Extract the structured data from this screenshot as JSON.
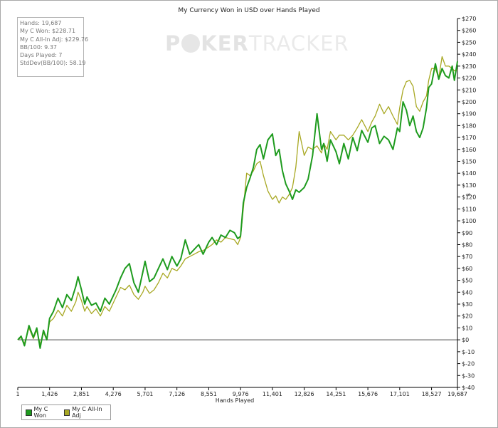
{
  "chart_data": {
    "type": "line",
    "title": "My Currency Won in USD over Hands Played",
    "xlabel": "Hands Played",
    "ylabel": "$",
    "xlim": [
      1,
      19687
    ],
    "ylim": [
      -40,
      270
    ],
    "x_ticks": [
      "1",
      "1,426",
      "2,851",
      "4,276",
      "5,701",
      "7,126",
      "8,551",
      "9,976",
      "11,401",
      "12,826",
      "14,251",
      "15,676",
      "17,101",
      "18,527",
      "19,687"
    ],
    "x_tick_values": [
      1,
      1426,
      2851,
      4276,
      5701,
      7126,
      8551,
      9976,
      11401,
      12826,
      14251,
      15676,
      17101,
      18527,
      19687
    ],
    "y_ticks": [
      "$-40",
      "$-30",
      "$-20",
      "$-10",
      "$0",
      "$10",
      "$20",
      "$30",
      "$40",
      "$50",
      "$60",
      "$70",
      "$80",
      "$90",
      "$100",
      "$110",
      "$120",
      "$130",
      "$140",
      "$150",
      "$160",
      "$170",
      "$180",
      "$190",
      "$200",
      "$210",
      "$220",
      "$230",
      "$240",
      "$250",
      "$260",
      "$270"
    ],
    "y_tick_values": [
      -40,
      -30,
      -20,
      -10,
      0,
      10,
      20,
      30,
      40,
      50,
      60,
      70,
      80,
      90,
      100,
      110,
      120,
      130,
      140,
      150,
      160,
      170,
      180,
      190,
      200,
      210,
      220,
      230,
      240,
      250,
      260,
      270
    ],
    "legend_position": "bottom-left",
    "grid": false,
    "series": [
      {
        "name": "My C Won",
        "color": "#1e9b1e",
        "x": [
          1,
          150,
          300,
          500,
          700,
          850,
          1000,
          1150,
          1300,
          1426,
          1600,
          1800,
          2000,
          2200,
          2400,
          2600,
          2700,
          2851,
          3000,
          3100,
          3300,
          3500,
          3700,
          3900,
          4100,
          4276,
          4400,
          4600,
          4800,
          5000,
          5200,
          5400,
          5600,
          5701,
          5900,
          6100,
          6300,
          6500,
          6700,
          6900,
          7126,
          7300,
          7500,
          7700,
          7900,
          8100,
          8300,
          8551,
          8700,
          8900,
          9100,
          9300,
          9500,
          9700,
          9850,
          9976,
          10100,
          10250,
          10400,
          10550,
          10700,
          10850,
          11000,
          11200,
          11401,
          11550,
          11700,
          11850,
          12000,
          12150,
          12300,
          12450,
          12600,
          12826,
          13000,
          13200,
          13400,
          13600,
          13700,
          13850,
          14000,
          14251,
          14400,
          14600,
          14800,
          15000,
          15200,
          15400,
          15676,
          15850,
          16000,
          16200,
          16400,
          16600,
          16800,
          17000,
          17101,
          17250,
          17400,
          17550,
          17700,
          17850,
          18000,
          18150,
          18300,
          18400,
          18527,
          18700,
          18850,
          19000,
          19150,
          19300,
          19450,
          19550,
          19687
        ],
        "y": [
          0,
          3,
          -5,
          12,
          2,
          10,
          -7,
          8,
          0,
          18,
          24,
          35,
          27,
          38,
          33,
          45,
          53,
          42,
          30,
          36,
          29,
          31,
          24,
          35,
          30,
          37,
          42,
          52,
          60,
          64,
          48,
          40,
          57,
          66,
          49,
          52,
          60,
          68,
          59,
          70,
          62,
          68,
          84,
          72,
          76,
          80,
          72,
          82,
          86,
          80,
          88,
          86,
          92,
          90,
          85,
          87,
          115,
          128,
          136,
          145,
          160,
          164,
          152,
          168,
          173,
          155,
          160,
          142,
          131,
          125,
          118,
          126,
          124,
          128,
          135,
          155,
          190,
          160,
          165,
          150,
          168,
          158,
          148,
          165,
          152,
          170,
          159,
          176,
          166,
          178,
          180,
          165,
          171,
          168,
          160,
          178,
          175,
          200,
          193,
          180,
          188,
          175,
          170,
          178,
          195,
          212,
          215,
          232,
          219,
          228,
          222,
          220,
          230,
          218,
          234
        ]
      },
      {
        "name": "My C All-In Adj",
        "color": "#a8a823",
        "x": [
          1,
          150,
          300,
          500,
          700,
          850,
          1000,
          1150,
          1300,
          1426,
          1600,
          1800,
          2000,
          2200,
          2400,
          2600,
          2700,
          2851,
          3000,
          3100,
          3300,
          3500,
          3700,
          3900,
          4100,
          4276,
          4400,
          4600,
          4800,
          5000,
          5200,
          5400,
          5600,
          5701,
          5900,
          6100,
          6300,
          6500,
          6700,
          6900,
          7126,
          7300,
          7500,
          7700,
          7900,
          8100,
          8300,
          8551,
          8700,
          8900,
          9100,
          9300,
          9500,
          9700,
          9850,
          9976,
          10100,
          10250,
          10400,
          10550,
          10700,
          10850,
          11000,
          11200,
          11401,
          11550,
          11700,
          11850,
          12000,
          12150,
          12300,
          12450,
          12600,
          12826,
          13000,
          13200,
          13400,
          13600,
          13700,
          13850,
          14000,
          14251,
          14400,
          14600,
          14800,
          15000,
          15200,
          15400,
          15676,
          15850,
          16000,
          16200,
          16400,
          16600,
          16800,
          17000,
          17101,
          17250,
          17400,
          17550,
          17700,
          17850,
          18000,
          18150,
          18300,
          18400,
          18527,
          18700,
          18850,
          19000,
          19150,
          19300,
          19450,
          19550,
          19687
        ],
        "y": [
          0,
          2,
          -3,
          10,
          1,
          8,
          -4,
          6,
          0,
          15,
          18,
          25,
          20,
          29,
          24,
          32,
          40,
          33,
          24,
          28,
          22,
          26,
          20,
          28,
          24,
          31,
          36,
          44,
          42,
          46,
          38,
          34,
          40,
          45,
          39,
          42,
          48,
          56,
          52,
          60,
          58,
          62,
          68,
          70,
          72,
          74,
          75,
          78,
          80,
          84,
          82,
          86,
          85,
          84,
          80,
          86,
          110,
          140,
          138,
          142,
          148,
          150,
          138,
          125,
          118,
          121,
          115,
          120,
          118,
          122,
          128,
          145,
          175,
          155,
          162,
          160,
          163,
          157,
          165,
          160,
          175,
          168,
          172,
          172,
          168,
          172,
          178,
          185,
          175,
          183,
          188,
          198,
          190,
          196,
          188,
          181,
          195,
          210,
          217,
          218,
          213,
          196,
          192,
          200,
          205,
          218,
          228,
          228,
          220,
          238,
          230,
          230,
          228,
          226,
          227
        ]
      }
    ]
  },
  "stats": {
    "hands": "Hands: 19,687",
    "won": "My C Won: $228.71",
    "allin": "My C All-In Adj: $229.76",
    "bb100": "BB/100: 9.37",
    "days": "Days Played: 7",
    "stddev": "StdDev(BB/100): 58.19"
  },
  "watermark": {
    "brand_left": "P",
    "brand_mid": "KER",
    "brand_right": "TRACKER"
  },
  "colors": {
    "won": "#1e9b1e",
    "allin": "#a8a823",
    "axis": "#000000"
  }
}
